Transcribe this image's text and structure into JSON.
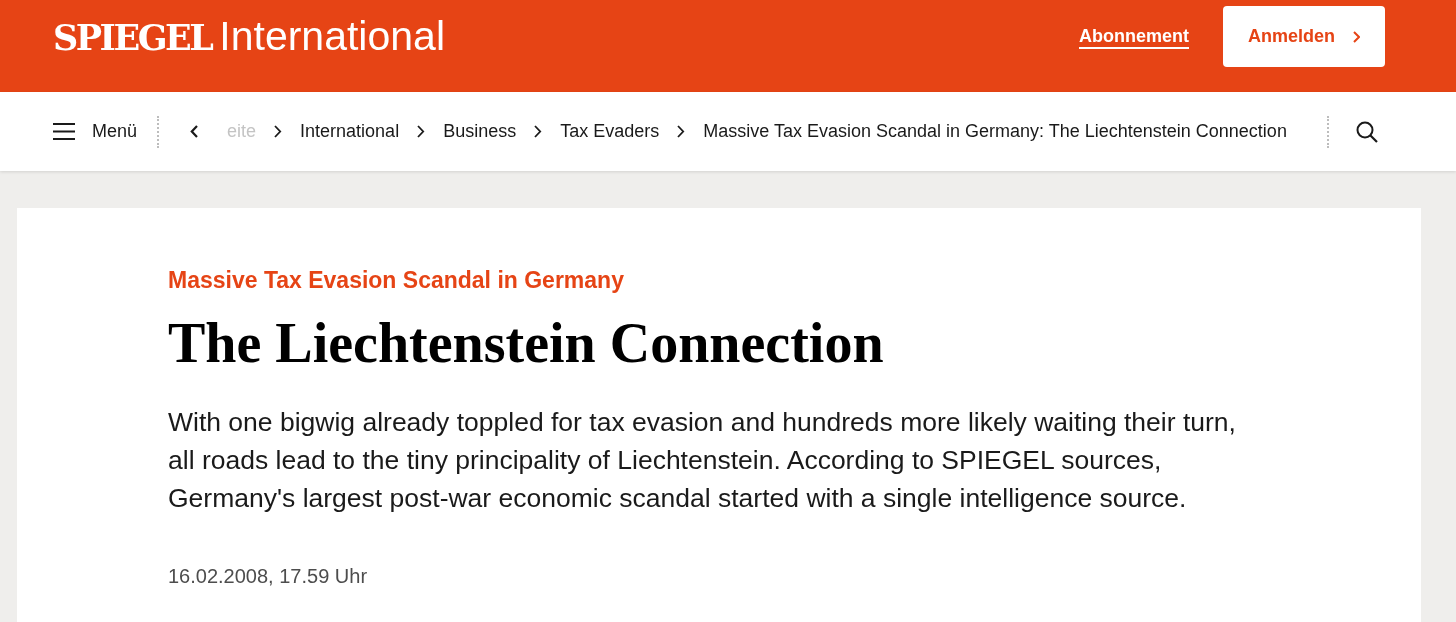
{
  "header": {
    "logo": {
      "wordmark": "SPIEGEL",
      "edition": "International"
    },
    "subscribe_link": "Abonnement",
    "login_button": "Anmelden"
  },
  "nav": {
    "menu_label": "Menü",
    "breadcrumbs": [
      {
        "label": "eite",
        "faded": true
      },
      {
        "label": "International",
        "faded": false
      },
      {
        "label": "Business",
        "faded": false
      },
      {
        "label": "Tax Evaders",
        "faded": false
      },
      {
        "label": "Massive Tax Evasion Scandal in Germany: The Liechtenstein Connection",
        "faded": false
      }
    ]
  },
  "article": {
    "kicker": "Massive Tax Evasion Scandal in Germany",
    "title": "The Liechtenstein Connection",
    "teaser": "With one bigwig already toppled for tax evasion and hundreds more likely waiting their turn,\nall roads lead to the tiny principality of Liechtenstein. According to SPIEGEL sources,\nGermany's largest post-war economic scandal started with a single intelligence source.",
    "date": "16.02.2008, 17.59 Uhr"
  }
}
